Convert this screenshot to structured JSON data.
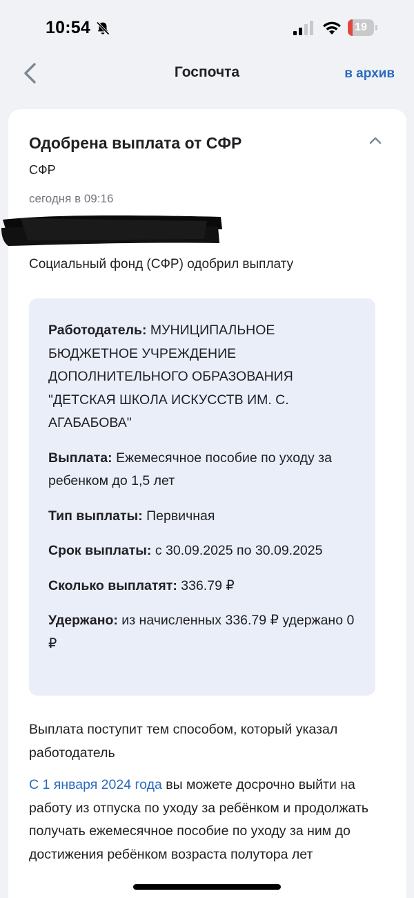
{
  "status": {
    "time": "10:54",
    "battery": "19",
    "battery_level": 0.19,
    "battery_color": "#e3453f"
  },
  "nav": {
    "title": "Госпочта",
    "archive_label": "в архив"
  },
  "message": {
    "title": "Одобрена выплата от СФР",
    "sender": "СФР",
    "timestamp": "сегодня в 09:16",
    "intro": "Социальный фонд (СФР) одобрил выплату",
    "details": [
      {
        "label": "Работодатель:",
        "value": "МУНИЦИПАЛЬНОЕ БЮДЖЕТНОЕ УЧРЕЖДЕНИЕ ДОПОЛНИТЕЛЬНОГО ОБРАЗОВАНИЯ \"ДЕТСКАЯ ШКОЛА ИСКУССТВ ИМ. С. АГАБАБОВА\""
      },
      {
        "label": "Выплата:",
        "value": "Ежемесячное пособие по уходу за ребенком до 1,5 лет"
      },
      {
        "label": "Тип выплаты:",
        "value": "Первичная"
      },
      {
        "label": "Срок выплаты:",
        "value": "с 30.09.2025 по 30.09.2025"
      },
      {
        "label": "Сколько выплатят:",
        "value": "336.79 ₽"
      },
      {
        "label": "Удержано:",
        "value": "из начисленных 336.79 ₽ удержано 0 ₽"
      }
    ],
    "paragraph1": "Выплата поступит тем способом, который указал работодатель",
    "paragraph2_link": "С 1 января 2024 года",
    "paragraph2_text": " вы можете досрочно выйти на работу из отпуска по уходу за ребёнком и продолжать получать ежемесячное пособие по уходу за ним до достижения ребёнком возраста полутора лет"
  },
  "colors": {
    "accent": "#2b6bbd",
    "info_box_bg": "#eaeef8",
    "background": "#f1f2f6"
  },
  "icons": {
    "back": "chevron-left-icon",
    "collapse": "chevron-up-icon",
    "bell": "bell-slash-icon",
    "signal": "cellular-signal-icon",
    "wifi": "wifi-icon"
  }
}
